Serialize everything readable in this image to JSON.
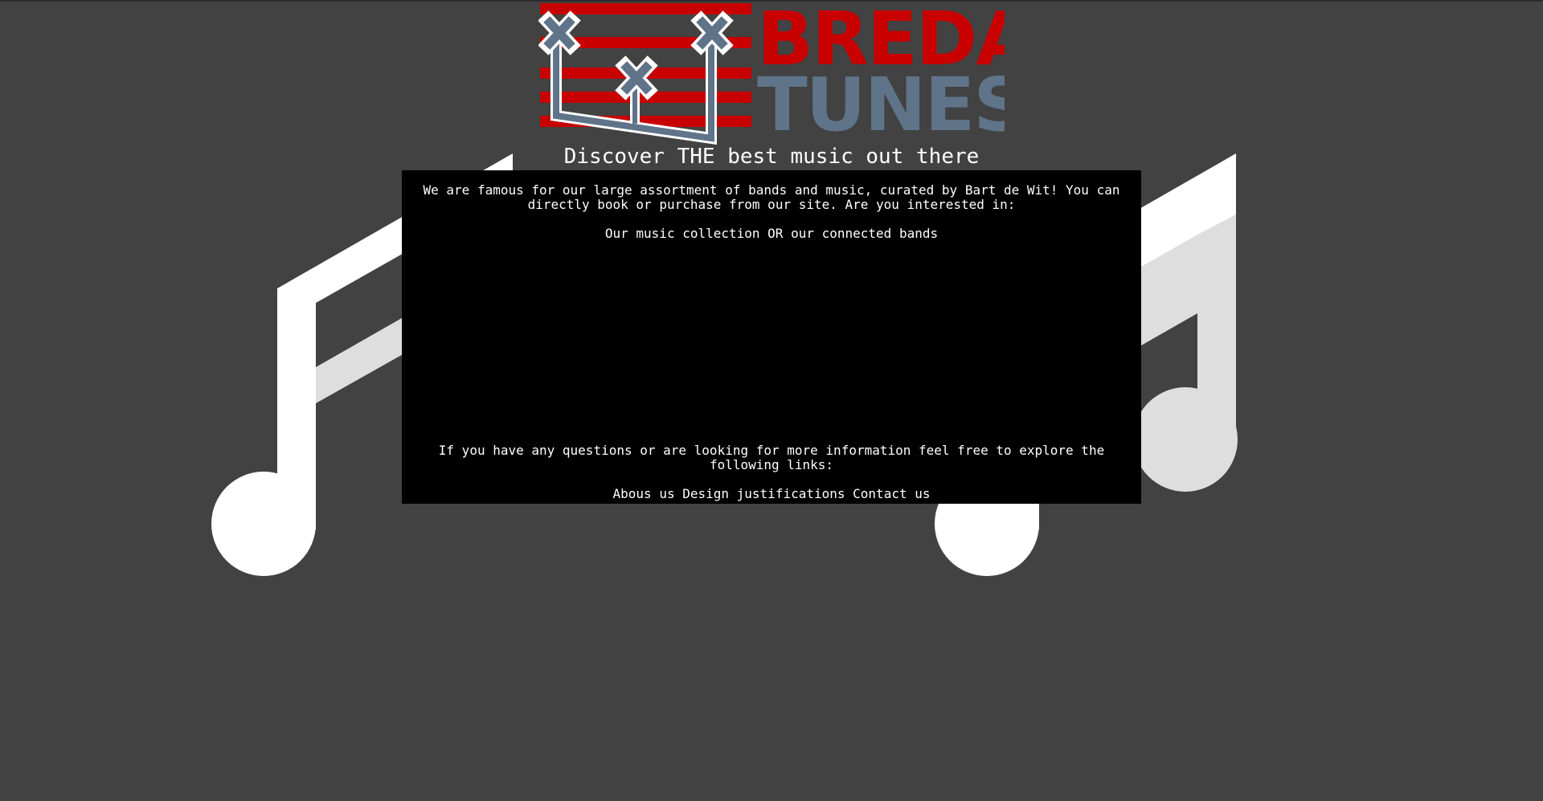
{
  "logo": {
    "word_top": "BREDA",
    "word_bottom": "TUNES",
    "color_red": "#c80000",
    "color_steel": "#5f7389"
  },
  "tagline": "Discover THE best music out there",
  "intro_text": "We are famous for our large assortment of bands and music, curated by Bart de Wit! You can directly book or purchase from our site. Are you interested in:",
  "choices": {
    "music_collection": "Our music collection",
    "separator": "OR",
    "connected_bands": "our connected bands"
  },
  "links_intro": "If you have any questions or are looking for more information feel free to explore the following links:",
  "footer_links": {
    "about": "Abous us",
    "design": "Design justifications",
    "contact": "Contact us"
  },
  "colors": {
    "background": "#424242",
    "box": "#000000",
    "text": "#ffffff",
    "note_white": "#ffffff",
    "note_light": "#dedede"
  }
}
